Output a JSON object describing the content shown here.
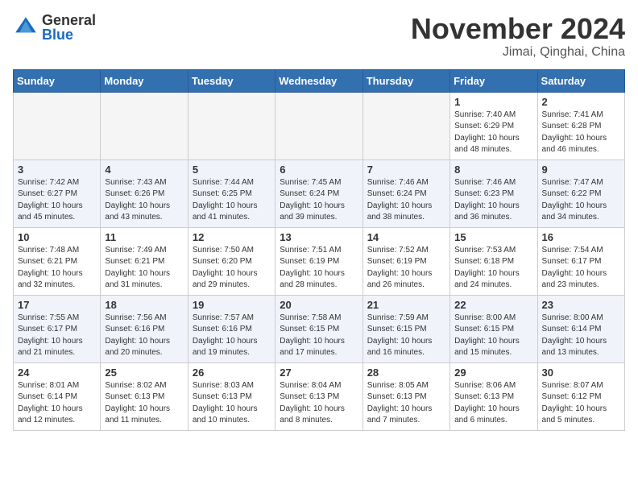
{
  "header": {
    "logo_general": "General",
    "logo_blue": "Blue",
    "month_title": "November 2024",
    "location": "Jimai, Qinghai, China"
  },
  "weekdays": [
    "Sunday",
    "Monday",
    "Tuesday",
    "Wednesday",
    "Thursday",
    "Friday",
    "Saturday"
  ],
  "weeks": [
    [
      {
        "day": "",
        "empty": true
      },
      {
        "day": "",
        "empty": true
      },
      {
        "day": "",
        "empty": true
      },
      {
        "day": "",
        "empty": true
      },
      {
        "day": "",
        "empty": true
      },
      {
        "day": "1",
        "sunrise": "7:40 AM",
        "sunset": "6:29 PM",
        "daylight": "10 hours and 48 minutes."
      },
      {
        "day": "2",
        "sunrise": "7:41 AM",
        "sunset": "6:28 PM",
        "daylight": "10 hours and 46 minutes."
      }
    ],
    [
      {
        "day": "3",
        "sunrise": "7:42 AM",
        "sunset": "6:27 PM",
        "daylight": "10 hours and 45 minutes."
      },
      {
        "day": "4",
        "sunrise": "7:43 AM",
        "sunset": "6:26 PM",
        "daylight": "10 hours and 43 minutes."
      },
      {
        "day": "5",
        "sunrise": "7:44 AM",
        "sunset": "6:25 PM",
        "daylight": "10 hours and 41 minutes."
      },
      {
        "day": "6",
        "sunrise": "7:45 AM",
        "sunset": "6:24 PM",
        "daylight": "10 hours and 39 minutes."
      },
      {
        "day": "7",
        "sunrise": "7:46 AM",
        "sunset": "6:24 PM",
        "daylight": "10 hours and 38 minutes."
      },
      {
        "day": "8",
        "sunrise": "7:46 AM",
        "sunset": "6:23 PM",
        "daylight": "10 hours and 36 minutes."
      },
      {
        "day": "9",
        "sunrise": "7:47 AM",
        "sunset": "6:22 PM",
        "daylight": "10 hours and 34 minutes."
      }
    ],
    [
      {
        "day": "10",
        "sunrise": "7:48 AM",
        "sunset": "6:21 PM",
        "daylight": "10 hours and 32 minutes."
      },
      {
        "day": "11",
        "sunrise": "7:49 AM",
        "sunset": "6:21 PM",
        "daylight": "10 hours and 31 minutes."
      },
      {
        "day": "12",
        "sunrise": "7:50 AM",
        "sunset": "6:20 PM",
        "daylight": "10 hours and 29 minutes."
      },
      {
        "day": "13",
        "sunrise": "7:51 AM",
        "sunset": "6:19 PM",
        "daylight": "10 hours and 28 minutes."
      },
      {
        "day": "14",
        "sunrise": "7:52 AM",
        "sunset": "6:19 PM",
        "daylight": "10 hours and 26 minutes."
      },
      {
        "day": "15",
        "sunrise": "7:53 AM",
        "sunset": "6:18 PM",
        "daylight": "10 hours and 24 minutes."
      },
      {
        "day": "16",
        "sunrise": "7:54 AM",
        "sunset": "6:17 PM",
        "daylight": "10 hours and 23 minutes."
      }
    ],
    [
      {
        "day": "17",
        "sunrise": "7:55 AM",
        "sunset": "6:17 PM",
        "daylight": "10 hours and 21 minutes."
      },
      {
        "day": "18",
        "sunrise": "7:56 AM",
        "sunset": "6:16 PM",
        "daylight": "10 hours and 20 minutes."
      },
      {
        "day": "19",
        "sunrise": "7:57 AM",
        "sunset": "6:16 PM",
        "daylight": "10 hours and 19 minutes."
      },
      {
        "day": "20",
        "sunrise": "7:58 AM",
        "sunset": "6:15 PM",
        "daylight": "10 hours and 17 minutes."
      },
      {
        "day": "21",
        "sunrise": "7:59 AM",
        "sunset": "6:15 PM",
        "daylight": "10 hours and 16 minutes."
      },
      {
        "day": "22",
        "sunrise": "8:00 AM",
        "sunset": "6:15 PM",
        "daylight": "10 hours and 15 minutes."
      },
      {
        "day": "23",
        "sunrise": "8:00 AM",
        "sunset": "6:14 PM",
        "daylight": "10 hours and 13 minutes."
      }
    ],
    [
      {
        "day": "24",
        "sunrise": "8:01 AM",
        "sunset": "6:14 PM",
        "daylight": "10 hours and 12 minutes."
      },
      {
        "day": "25",
        "sunrise": "8:02 AM",
        "sunset": "6:13 PM",
        "daylight": "10 hours and 11 minutes."
      },
      {
        "day": "26",
        "sunrise": "8:03 AM",
        "sunset": "6:13 PM",
        "daylight": "10 hours and 10 minutes."
      },
      {
        "day": "27",
        "sunrise": "8:04 AM",
        "sunset": "6:13 PM",
        "daylight": "10 hours and 8 minutes."
      },
      {
        "day": "28",
        "sunrise": "8:05 AM",
        "sunset": "6:13 PM",
        "daylight": "10 hours and 7 minutes."
      },
      {
        "day": "29",
        "sunrise": "8:06 AM",
        "sunset": "6:13 PM",
        "daylight": "10 hours and 6 minutes."
      },
      {
        "day": "30",
        "sunrise": "8:07 AM",
        "sunset": "6:12 PM",
        "daylight": "10 hours and 5 minutes."
      }
    ]
  ]
}
